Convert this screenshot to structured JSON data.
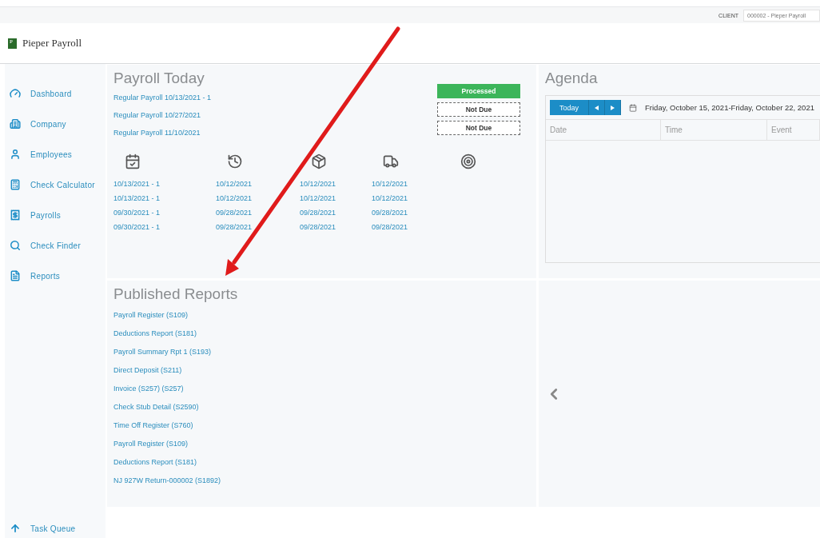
{
  "topbar": {
    "client_label": "CLIENT",
    "client_value": "000002 - Pieper Payroll"
  },
  "brand": {
    "logo_letter": "P",
    "name": "Pieper Payroll"
  },
  "sidebar": {
    "items": [
      {
        "label": "Dashboard",
        "kind": "gauge"
      },
      {
        "label": "Company",
        "kind": "building"
      },
      {
        "label": "Employees",
        "kind": "person"
      },
      {
        "label": "Check Calculator",
        "kind": "calculator"
      },
      {
        "label": "Payrolls",
        "kind": "payroll"
      },
      {
        "label": "Check Finder",
        "kind": "search"
      },
      {
        "label": "Reports",
        "kind": "report"
      }
    ],
    "footer_item": {
      "label": "Task Queue"
    }
  },
  "payroll_today": {
    "title": "Payroll Today",
    "payrolls": [
      {
        "name": "Regular Payroll 10/13/2021 - 1",
        "status": "Processed",
        "kind": "processed"
      },
      {
        "name": "Regular Payroll 10/27/2021",
        "status": "Not Due",
        "kind": "not_due"
      },
      {
        "name": "Regular Payroll 11/10/2021",
        "status": "Not Due",
        "kind": "not_due"
      }
    ],
    "columns": [
      {
        "kind": "calendar"
      },
      {
        "kind": "history"
      },
      {
        "kind": "box"
      },
      {
        "kind": "truck"
      },
      {
        "kind": "target"
      }
    ],
    "rows": [
      [
        "10/13/2021 - 1",
        "10/12/2021",
        "10/12/2021",
        "10/12/2021"
      ],
      [
        "10/13/2021 - 1",
        "10/12/2021",
        "10/12/2021",
        "10/12/2021"
      ],
      [
        "09/30/2021 - 1",
        "09/28/2021",
        "09/28/2021",
        "09/28/2021"
      ],
      [
        "09/30/2021 - 1",
        "09/28/2021",
        "09/28/2021",
        "09/28/2021"
      ]
    ]
  },
  "agenda": {
    "title": "Agenda",
    "today_button": "Today",
    "range": "Friday, October 15, 2021-Friday, October 22, 2021",
    "columns": [
      "Date",
      "Time",
      "Event"
    ]
  },
  "published_reports": {
    "title": "Published Reports",
    "items": [
      "Payroll Register (S109)",
      "Deductions Report (S181)",
      "Payroll Summary Rpt 1 (S193)",
      "Direct Deposit (S211)",
      "Invoice (S257) (S257)",
      "Check Stub Detail (S2590)",
      "Time Off Register (S760)",
      "Payroll Register (S109)",
      "Deductions Report (S181)",
      "NJ 927W Return-000002 (S1892)"
    ]
  }
}
